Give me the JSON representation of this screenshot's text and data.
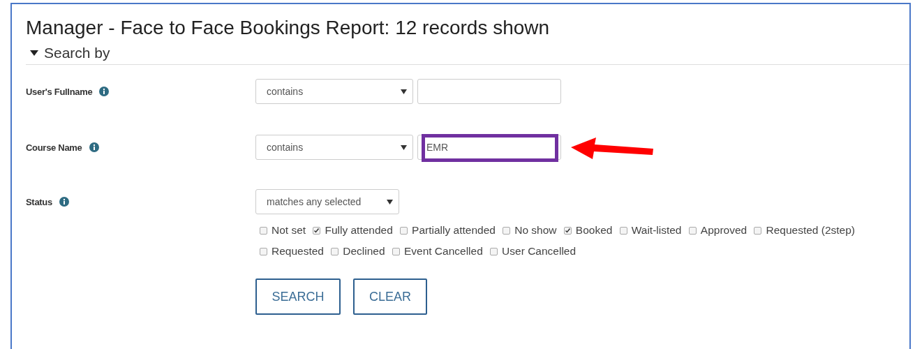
{
  "title": "Manager - Face to Face Bookings Report: 12 records shown",
  "search_section": {
    "label": "Search by",
    "expanded": true
  },
  "filters": [
    {
      "kind": "text",
      "label": "User's Fullname",
      "operator": "contains",
      "highlighted": false
    },
    {
      "kind": "text",
      "label": "Course Name",
      "operator": "contains",
      "value": "EMR",
      "highlighted": true
    },
    {
      "kind": "status",
      "label": "Status",
      "operator": "matches any selected",
      "options": [
        {
          "label": "Not set",
          "checked": false
        },
        {
          "label": "Fully attended",
          "checked": true
        },
        {
          "label": "Partially attended",
          "checked": false
        },
        {
          "label": "No show",
          "checked": false
        },
        {
          "label": "Booked",
          "checked": true
        },
        {
          "label": "Wait-listed",
          "checked": false
        },
        {
          "label": "Approved",
          "checked": false
        },
        {
          "label": "Requested (2step)",
          "checked": false
        },
        {
          "label": "Requested",
          "checked": false
        },
        {
          "label": "Declined",
          "checked": false
        },
        {
          "label": "Event Cancelled",
          "checked": false
        },
        {
          "label": "User Cancelled",
          "checked": false
        }
      ]
    }
  ],
  "buttons": [
    "SEARCH",
    "CLEAR"
  ]
}
